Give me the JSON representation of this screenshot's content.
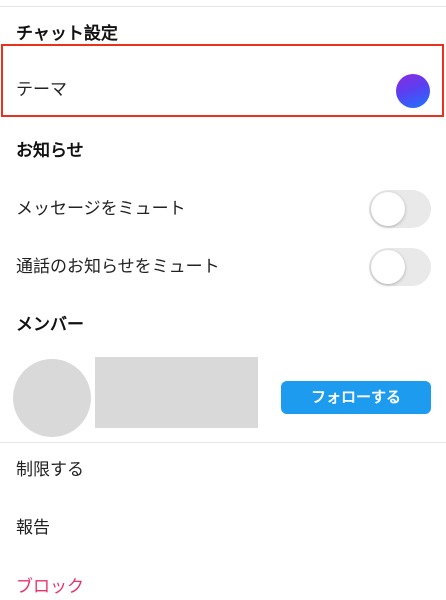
{
  "chat_settings": {
    "header": "チャット設定",
    "theme_label": "テーマ",
    "theme_swatch_color": "#5a3ff0"
  },
  "notifications": {
    "header": "お知らせ",
    "mute_messages_label": "メッセージをミュート",
    "mute_messages_on": false,
    "mute_calls_label": "通話のお知らせをミュート",
    "mute_calls_on": false
  },
  "members": {
    "header": "メンバー",
    "follow_button_label": "フォローする"
  },
  "actions": {
    "restrict_label": "制限する",
    "report_label": "報告",
    "block_label": "ブロック"
  },
  "colors": {
    "accent_blue": "#1c9bef",
    "block_pink": "#e8326b",
    "highlight_red": "#e8321e"
  }
}
